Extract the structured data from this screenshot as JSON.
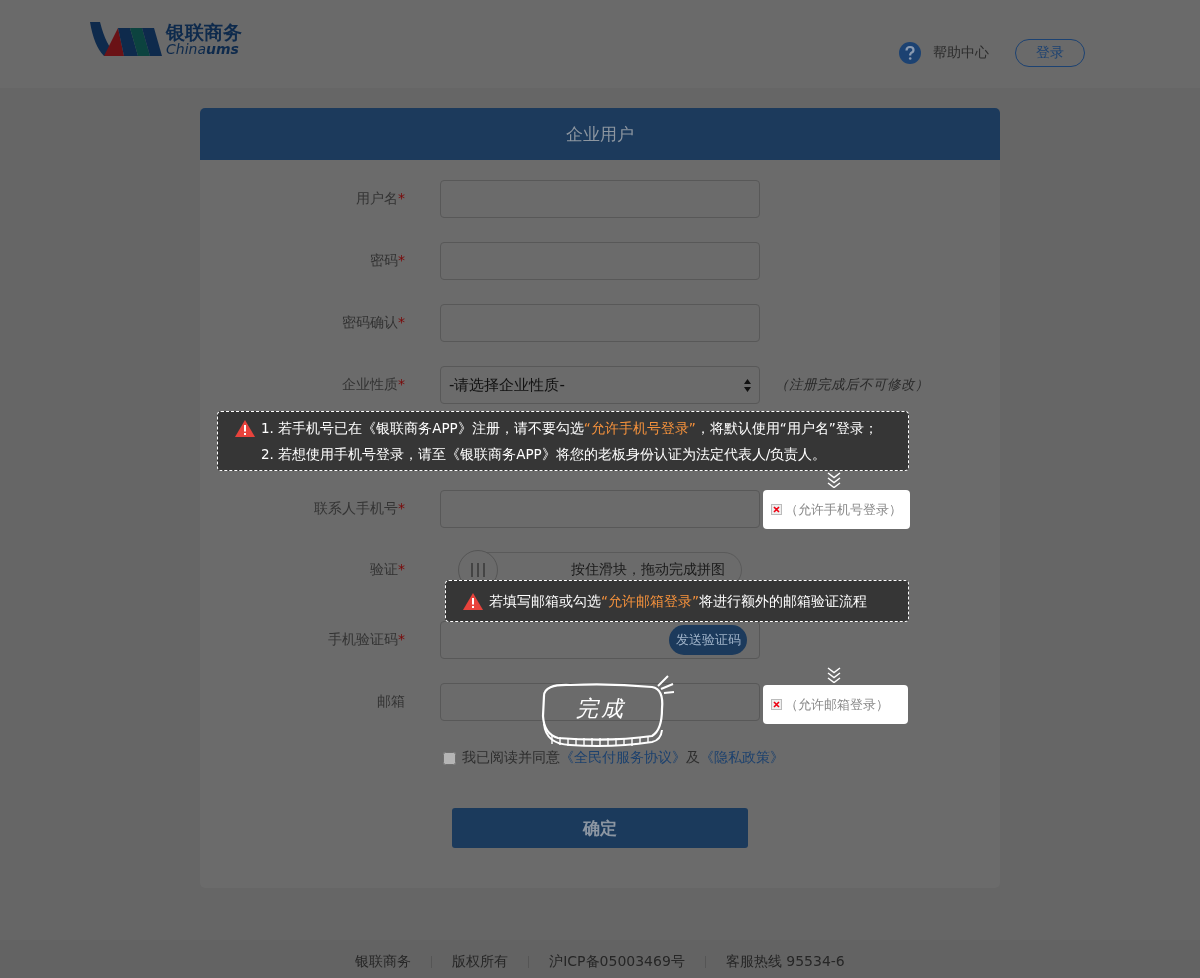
{
  "header": {
    "logo_text": "银联商务",
    "logo_sub": "China",
    "logo_sub_bold": "ums",
    "help": "帮助中心",
    "login": "登录"
  },
  "card": {
    "title": "企业用户"
  },
  "fields": [
    {
      "kind": "input",
      "label": "用户名",
      "marker": "*"
    },
    {
      "kind": "input",
      "label": "密码",
      "marker": "*"
    },
    {
      "kind": "input",
      "label": "密码确认",
      "marker": "*"
    },
    {
      "kind": "select",
      "label": "企业性质",
      "marker": "*",
      "value": "-请选择企业性质-",
      "note": "（注册完成后不可修改）"
    },
    {
      "kind": "input",
      "label": "联系人手机号",
      "marker": "*"
    },
    {
      "kind": "slider",
      "label": "验证",
      "marker": "*",
      "hint": "按住滑块，拖动完成拼图",
      "level": 0
    },
    {
      "kind": "code",
      "label": "手机验证码",
      "marker": "*",
      "button": "发送验证码"
    },
    {
      "kind": "input",
      "label": "邮箱"
    }
  ],
  "agreement": {
    "checked": false,
    "text": "我已阅读并同意",
    "link1": "《全民付服务协议》",
    "joiner": "及",
    "link2": "《隐私政策》"
  },
  "submit": "确定",
  "guides": [
    {
      "lines": [
        {
          "before": "1. 若手机号已在《银联商务APP》注册，请不要勾选",
          "highlight": "“允许手机号登录”",
          "after": "，将默认使用“用户名”登录；"
        },
        {
          "before": "2. 若想使用手机号登录，请至《银联商务APP》将您的老板身份认证为法定代表人/负责人。"
        }
      ],
      "option": "（允许手机号登录）"
    },
    {
      "lines": [
        {
          "before": "若填写邮箱或勾选",
          "highlight": "“允许邮箱登录”",
          "after": "将进行额外的邮箱验证流程"
        }
      ],
      "option": "（允许邮箱登录）"
    }
  ],
  "sticker": "完成",
  "footer": [
    "银联商务",
    "版权所有",
    "沪ICP备05003469号",
    "客服热线 95534-6"
  ]
}
